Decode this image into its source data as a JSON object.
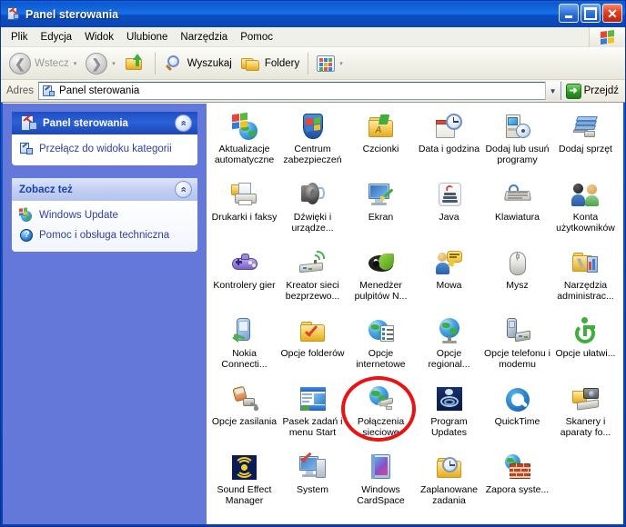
{
  "window": {
    "title": "Panel sterowania",
    "title_icon": "control-panel-icon",
    "buttons": {
      "minimize": "_",
      "maximize": "□",
      "close": "✕"
    }
  },
  "menubar": {
    "items": [
      {
        "label": "Plik"
      },
      {
        "label": "Edycja"
      },
      {
        "label": "Widok"
      },
      {
        "label": "Ulubione"
      },
      {
        "label": "Narzędzia"
      },
      {
        "label": "Pomoc"
      }
    ],
    "flag_icon": "windows-flag-icon"
  },
  "toolbar": {
    "back_label": "Wstecz",
    "back_icon": "back-arrow-icon",
    "forward_icon": "forward-arrow-icon",
    "up_icon": "up-folder-icon",
    "search_label": "Wyszukaj",
    "search_icon": "magnifier-icon",
    "folders_label": "Foldery",
    "folders_icon": "folders-icon",
    "views_icon": "views-grid-icon",
    "dropdown_arrow": "▾"
  },
  "addressbar": {
    "label": "Adres",
    "value": "Panel sterowania",
    "icon": "control-panel-icon",
    "dropdown_icon": "chevron-down-icon",
    "go_label": "Przejdź",
    "go_icon": "green-arrow-icon"
  },
  "sidebar": {
    "panels": [
      {
        "title": "Panel sterowania",
        "icon": "control-panel-icon",
        "style": "dark",
        "collapse_icon": "chevron-up-icon",
        "links": [
          {
            "label": "Przełącz do widoku kategorii",
            "icon": "category-view-icon"
          }
        ]
      },
      {
        "title": "Zobacz też",
        "style": "light",
        "collapse_icon": "chevron-up-icon",
        "links": [
          {
            "label": "Windows Update",
            "icon": "windows-update-icon"
          },
          {
            "label": "Pomoc i obsługa techniczna",
            "icon": "help-icon"
          }
        ]
      }
    ]
  },
  "content": {
    "items": [
      {
        "label": "Aktualizacje automatyczne",
        "icon": "automatic-updates-icon"
      },
      {
        "label": "Centrum zabezpieczeń",
        "icon": "security-center-icon"
      },
      {
        "label": "Czcionki",
        "icon": "fonts-folder-icon"
      },
      {
        "label": "Data i godzina",
        "icon": "date-time-icon"
      },
      {
        "label": "Dodaj lub usuń programy",
        "icon": "add-remove-programs-icon"
      },
      {
        "label": "Dodaj sprzęt",
        "icon": "add-hardware-icon"
      },
      {
        "label": "Drukarki i faksy",
        "icon": "printers-faxes-icon"
      },
      {
        "label": "Dźwięki i urządze...",
        "icon": "sounds-audio-icon"
      },
      {
        "label": "Ekran",
        "icon": "display-icon"
      },
      {
        "label": "Java",
        "icon": "java-icon"
      },
      {
        "label": "Klawiatura",
        "icon": "keyboard-icon"
      },
      {
        "label": "Konta użytkowników",
        "icon": "user-accounts-icon"
      },
      {
        "label": "Kontrolery gier",
        "icon": "game-controllers-icon"
      },
      {
        "label": "Kreator sieci bezprzewo...",
        "icon": "wireless-network-wizard-icon"
      },
      {
        "label": "Menedżer pulpitów N...",
        "icon": "nvidia-desktop-manager-icon"
      },
      {
        "label": "Mowa",
        "icon": "speech-icon"
      },
      {
        "label": "Mysz",
        "icon": "mouse-icon"
      },
      {
        "label": "Narzędzia administrac...",
        "icon": "administrative-tools-icon"
      },
      {
        "label": "Nokia Connecti...",
        "icon": "nokia-connectivity-icon"
      },
      {
        "label": "Opcje folderów",
        "icon": "folder-options-icon"
      },
      {
        "label": "Opcje internetowe",
        "icon": "internet-options-icon"
      },
      {
        "label": "Opcje regional...",
        "icon": "regional-options-icon"
      },
      {
        "label": "Opcje telefonu i modemu",
        "icon": "phone-modem-icon"
      },
      {
        "label": "Opcje ułatwi...",
        "icon": "accessibility-options-icon"
      },
      {
        "label": "Opcje zasilania",
        "icon": "power-options-icon"
      },
      {
        "label": "Pasek zadań i menu Start",
        "icon": "taskbar-start-menu-icon"
      },
      {
        "label": "Połączenia sieciowe",
        "icon": "network-connections-icon"
      },
      {
        "label": "Program Updates",
        "icon": "program-updates-icon"
      },
      {
        "label": "QuickTime",
        "icon": "quicktime-icon"
      },
      {
        "label": "Skanery i aparaty fo...",
        "icon": "scanners-cameras-icon"
      },
      {
        "label": "Sound Effect Manager",
        "icon": "sound-effect-manager-icon"
      },
      {
        "label": "System",
        "icon": "system-icon"
      },
      {
        "label": "Windows CardSpace",
        "icon": "windows-cardspace-icon"
      },
      {
        "label": "Zaplanowane zadania",
        "icon": "scheduled-tasks-icon"
      },
      {
        "label": "Zapora syste...",
        "icon": "windows-firewall-icon"
      }
    ],
    "annotation": {
      "shape": "ellipse",
      "color": "#e81414",
      "target_label": "Połączenia sieciowe"
    }
  },
  "colors": {
    "titlebar_blue": "#0b59cf",
    "sidebar_blue": "#6378d8",
    "annotation_red": "#e81414",
    "link_blue": "#30419c"
  }
}
